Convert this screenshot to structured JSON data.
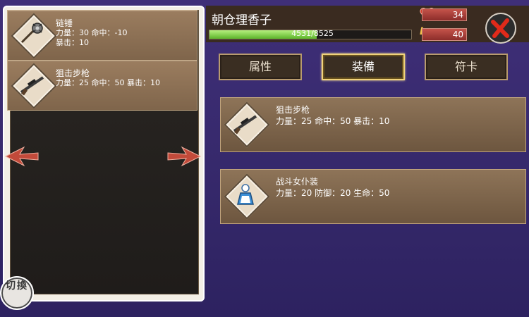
{
  "character": {
    "name": "朝仓理香子",
    "xp_text": "4531/8525",
    "xp_fraction": 0.53,
    "hp": "34",
    "level": "40",
    "lv_label": "Lv"
  },
  "tabs": [
    {
      "label": "属性",
      "active": false
    },
    {
      "label": "装備",
      "active": true
    },
    {
      "label": "符卡",
      "active": false
    }
  ],
  "inventory": [
    {
      "name": "链锤",
      "stats": "力量：30 命中：-10\n暴击：10",
      "icon": "flail-icon"
    },
    {
      "name": "狙击步枪",
      "stats": "力量：25 命中：50 暴击：10",
      "icon": "sniper-rifle-icon"
    }
  ],
  "equipped": [
    {
      "name": "狙击步枪",
      "stats": "力量：25 命中：50 暴击：10",
      "icon": "sniper-rifle-icon"
    },
    {
      "name": "战斗女仆装",
      "stats": "力量：20 防御：20 生命：50",
      "icon": "maid-outfit-icon"
    }
  ],
  "switch_label": "切換",
  "colors": {
    "accent": "#f0d27a",
    "xp": "#7ad23e",
    "hp": "#c5534a",
    "bg": "#3f2f78"
  }
}
